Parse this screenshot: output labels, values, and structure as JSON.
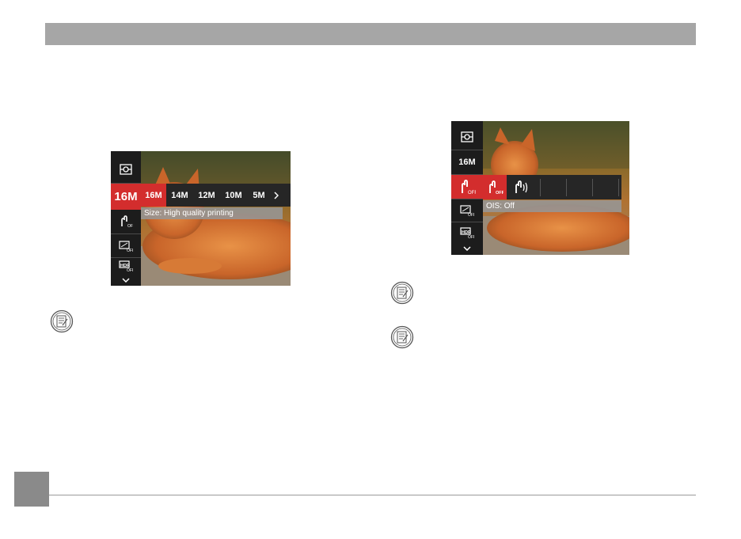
{
  "page": {
    "header_text": "",
    "page_number": ""
  },
  "screen_left": {
    "sidebar": [
      {
        "label": "",
        "icon": "metering-icon"
      },
      {
        "label": "16M",
        "icon": "image-size-icon"
      },
      {
        "label": "",
        "icon": "ois-off-icon"
      },
      {
        "label": "",
        "icon": "continuous-af-off-icon"
      },
      {
        "label": "",
        "icon": "hdr-off-icon"
      },
      {
        "label": "",
        "icon": "chevron-down-icon"
      }
    ],
    "selected_sidebar": 1,
    "options": [
      "16M",
      "14M",
      "12M",
      "10M",
      "5M"
    ],
    "selected_option": 0,
    "description": "Size: High quality printing"
  },
  "screen_right": {
    "sidebar": [
      {
        "label": "",
        "icon": "metering-icon"
      },
      {
        "label": "16M",
        "icon": "image-size-icon"
      },
      {
        "label": "",
        "icon": "ois-off-icon"
      },
      {
        "label": "",
        "icon": "continuous-af-off-icon"
      },
      {
        "label": "",
        "icon": "hdr-off-icon"
      },
      {
        "label": "",
        "icon": "chevron-down-icon"
      }
    ],
    "selected_sidebar": 2,
    "options": [
      "ois-off",
      "ois-on"
    ],
    "selected_option": 0,
    "description": "OIS: Off"
  },
  "notes": [
    "note-icon",
    "note-icon",
    "note-icon"
  ],
  "colors": {
    "accent": "#d32d2d",
    "header": "#a6a6a6",
    "sidebar": "#1c1c1c"
  }
}
